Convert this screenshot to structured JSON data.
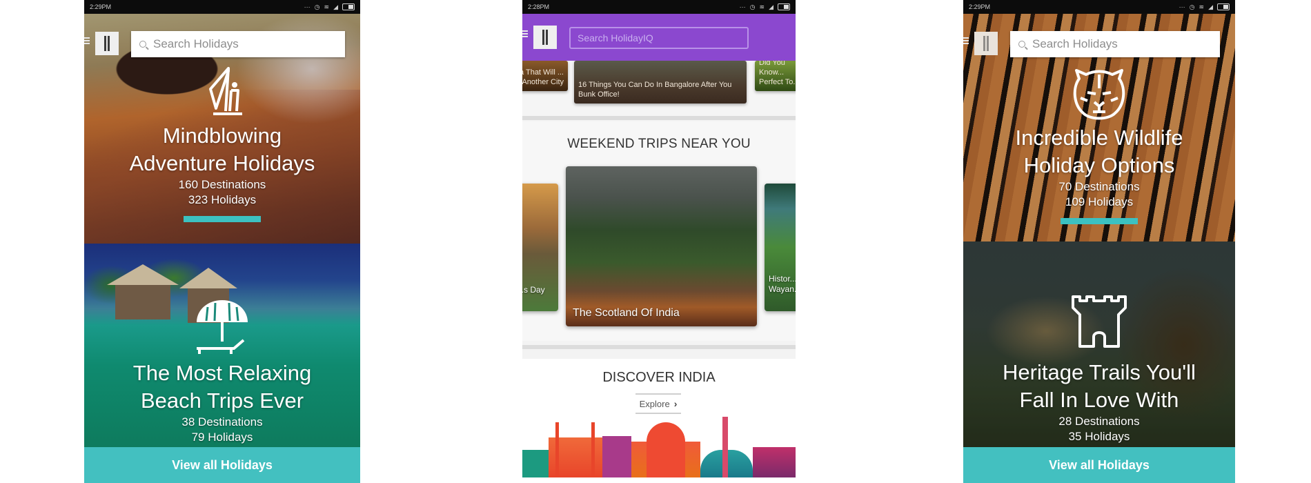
{
  "phones": {
    "left": {
      "status_time": "2:29PM",
      "search_placeholder": "Search Holidays",
      "categories": [
        {
          "title_line1": "Mindblowing",
          "title_line2": "Adventure Holidays",
          "destinations": "160 Destinations",
          "holidays": "323 Holidays",
          "icon": "adventure-climber-icon"
        },
        {
          "title_line1": "The Most Relaxing",
          "title_line2": "Beach Trips Ever",
          "destinations": "38 Destinations",
          "holidays": "79 Holidays",
          "icon": "beach-umbrella-icon"
        }
      ],
      "cta_label": "View all Holidays"
    },
    "middle": {
      "status_time": "2:28PM",
      "search_placeholder": "Search HolidayIQ",
      "articles": [
        {
          "title": "...ta That Will ... Another City"
        },
        {
          "title": "16 Things You Can Do In Bangalore After You Bunk Office!"
        },
        {
          "title": "Did You Know... Perfect To..."
        }
      ],
      "weekend_title": "WEEKEND TRIPS NEAR YOU",
      "trips": [
        {
          "label": "...s Day"
        },
        {
          "label": "The Scotland Of India"
        },
        {
          "label": "Histor... Wayan..."
        }
      ],
      "discover_title": "DISCOVER INDIA",
      "explore_label": "Explore",
      "accent_color": "#8b48cf"
    },
    "right": {
      "status_time": "2:29PM",
      "search_placeholder": "Search Holidays",
      "categories": [
        {
          "title_line1": "Incredible Wildlife",
          "title_line2": "Holiday Options",
          "destinations": "70 Destinations",
          "holidays": "109 Holidays",
          "icon": "tiger-icon"
        },
        {
          "title_line1": "Heritage Trails You'll",
          "title_line2": "Fall In Love With",
          "destinations": "28 Destinations",
          "holidays": "35 Holidays",
          "icon": "castle-tower-icon"
        }
      ],
      "cta_label": "View all Holidays"
    }
  },
  "colors": {
    "teal_cta": "#43c0c0",
    "purple_header": "#8b48cf"
  }
}
